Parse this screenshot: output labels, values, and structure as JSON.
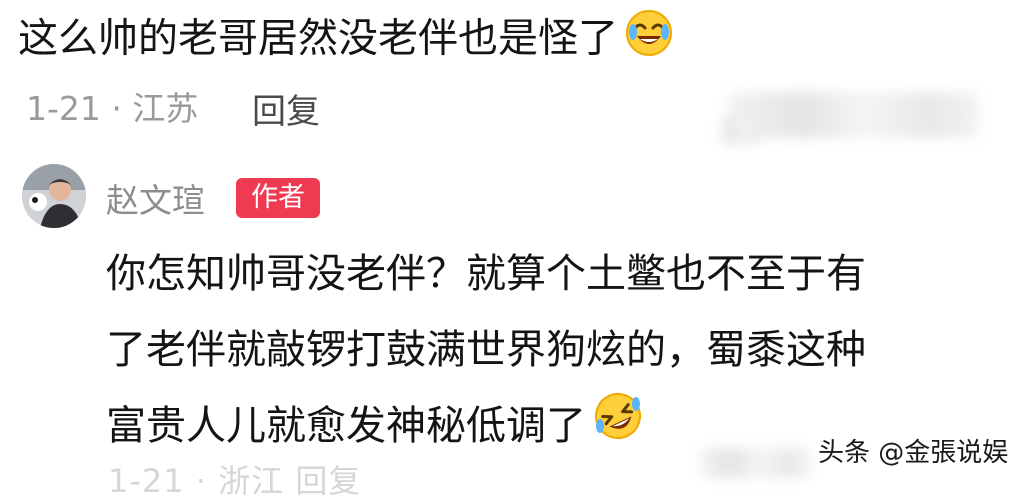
{
  "comment": {
    "text": "这么帅的老哥居然没老伴也是怪了",
    "emoji": "crying-laughing-emoji",
    "meta": "1-21 · 江苏",
    "reply_label": "回复"
  },
  "reply": {
    "author": "赵文瑄",
    "badge": "作者",
    "lines": [
      "你怎知帅哥没老伴？就算个土鳖也不至于有",
      "了老伴就敲锣打鼓满世界狗炫的，蜀黍这种",
      "富贵人儿就愈发神秘低调了"
    ],
    "emoji": "rolling-laughing-emoji"
  },
  "watermark": "头条 @金張说娱",
  "next_meta_partial": "1-21 · 浙江    回复",
  "colors": {
    "badge": "#ef3b52",
    "meta": "#9a9a9a",
    "text": "#141414"
  }
}
